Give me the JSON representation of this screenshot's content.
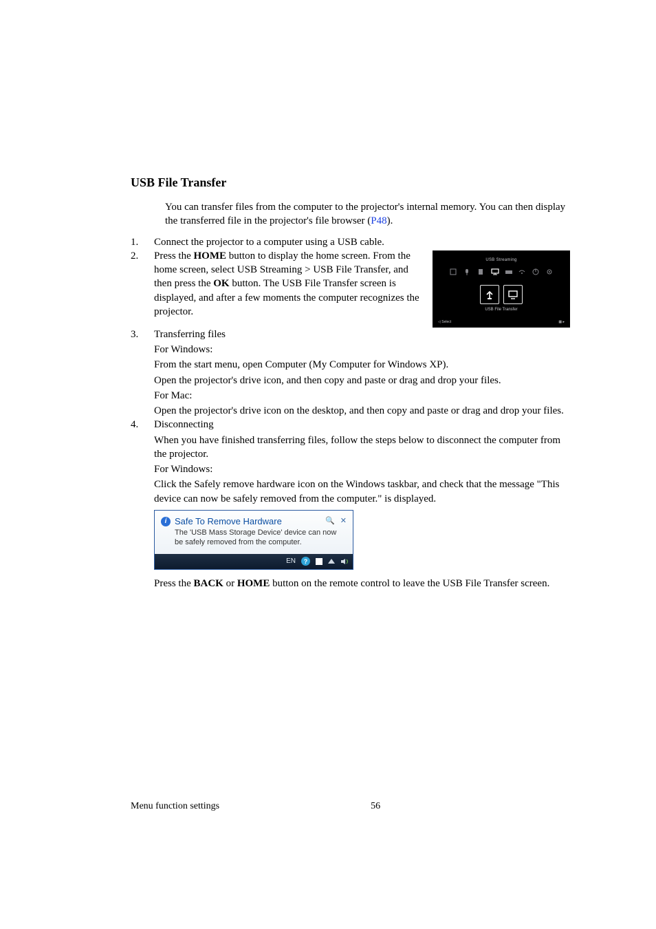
{
  "heading": "USB File Transfer",
  "intro_pre": "You can transfer files from the computer to the projector's internal memory. You can then display the transferred file in the projector's file browser (",
  "intro_link": "P48",
  "intro_post": ").",
  "steps": {
    "s1": {
      "num": "1.",
      "text": "Connect the projector to a computer using a USB cable."
    },
    "s2": {
      "num": "2.",
      "p1_pre": "Press the ",
      "p1_b1": "HOME",
      "p1_mid1": " button to display the home screen. From the home screen, select USB Streaming > USB File Transfer, and then press the ",
      "p1_b2": "OK",
      "p1_post": " button. The USB File Transfer screen is displayed, and after a few moments the computer recognizes the projector."
    },
    "s3": {
      "num": "3.",
      "title": "Transferring files",
      "win_label": "For Windows:",
      "win_l1": "From the start menu, open Computer (My Computer for Windows XP).",
      "win_l2": "Open the projector's drive icon, and then copy and paste or drag and drop your files.",
      "mac_label": "For Mac:",
      "mac_l1": "Open the projector's drive icon on the desktop, and then copy and paste or drag and drop your files."
    },
    "s4": {
      "num": "4.",
      "title": "Disconnecting",
      "d1": "When you have finished transferring files, follow the steps below to disconnect the computer from the projector.",
      "win_label": "For Windows:",
      "d2": "Click the Safely remove hardware icon on the Windows taskbar, and check that the message \"This device can now be safely removed from the computer.\" is displayed.",
      "final_pre": "Press the ",
      "final_b1": "BACK",
      "final_mid": " or ",
      "final_b2": "HOME",
      "final_post": " button on the remote control to leave the USB File Transfer screen."
    }
  },
  "fig1": {
    "top": "USB Streaming",
    "caption": "USB File Transfer",
    "left_hint": "◁ Select",
    "right_hint": "▦ ▸"
  },
  "fig2": {
    "title": "Safe To Remove Hardware",
    "msg": "The 'USB Mass Storage Device' device can now be safely removed from the computer.",
    "lang": "EN"
  },
  "footer": {
    "section": "Menu function settings",
    "page": "56"
  }
}
